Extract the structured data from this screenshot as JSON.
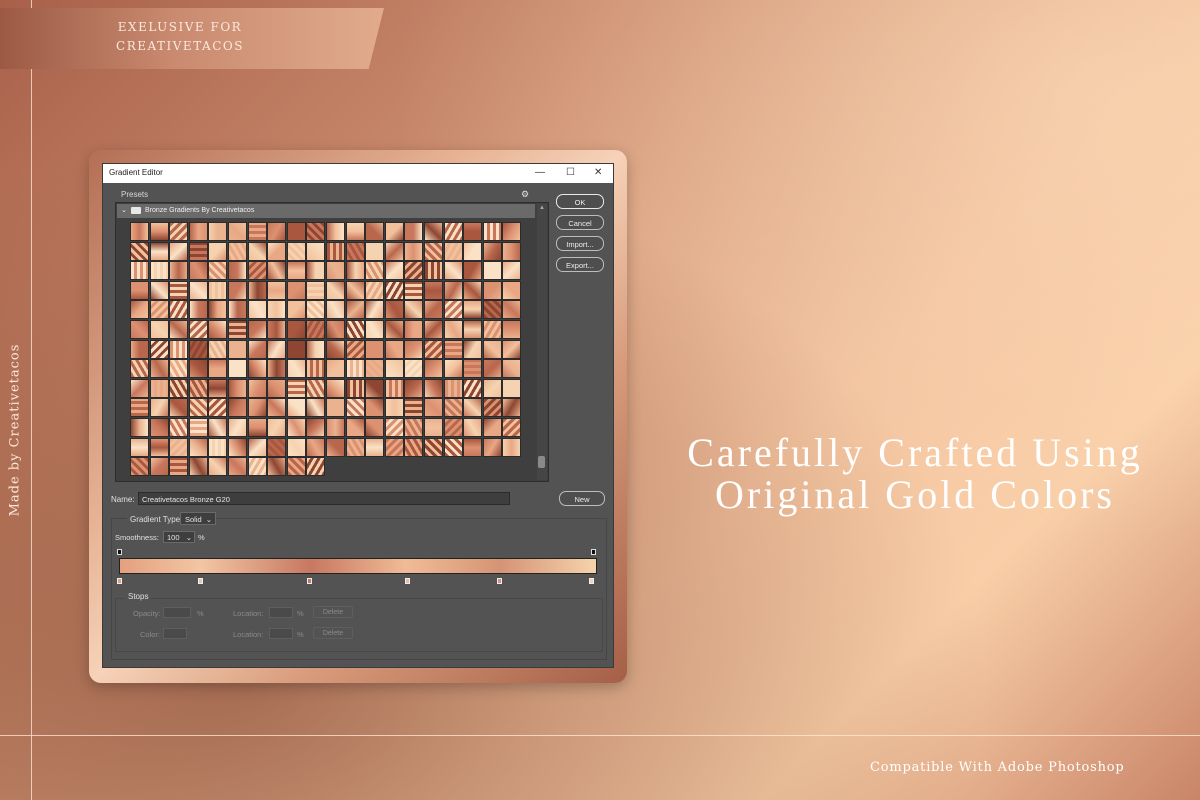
{
  "ribbon": {
    "line1": "EXELUSIVE FOR",
    "line2": "CREATIVETACOS"
  },
  "side_text": "Made by Creativetacos",
  "headline": {
    "line1": "Carefully Crafted Using",
    "line2": "Original Gold Colors"
  },
  "footer_text": "Compatible With Adobe Photoshop",
  "dialog": {
    "title": "Gradient Editor",
    "window_controls": {
      "minimize": "—",
      "maximize": "☐",
      "close": "✕"
    },
    "presets_label": "Presets",
    "gear_icon": "⚙",
    "group_label": "Bronze Gradients By Creativetacos",
    "buttons": {
      "ok": "OK",
      "cancel": "Cancel",
      "import": "Import...",
      "export": "Export...",
      "new": "New"
    },
    "name_label": "Name:",
    "name_value": "Creativetacos Bronze G20",
    "gradient_type_label": "Gradient Type:",
    "gradient_type_value": "Solid",
    "smoothness_label": "Smoothness:",
    "smoothness_value": "100",
    "smoothness_unit": "%",
    "stops_label": "Stops",
    "opacity_label": "Opacity:",
    "color_label": "Color:",
    "location_label": "Location:",
    "percent": "%",
    "delete_label": "Delete"
  },
  "colors": {
    "dialog_bg": "#535353",
    "accent_copper": "#c98a6c"
  }
}
